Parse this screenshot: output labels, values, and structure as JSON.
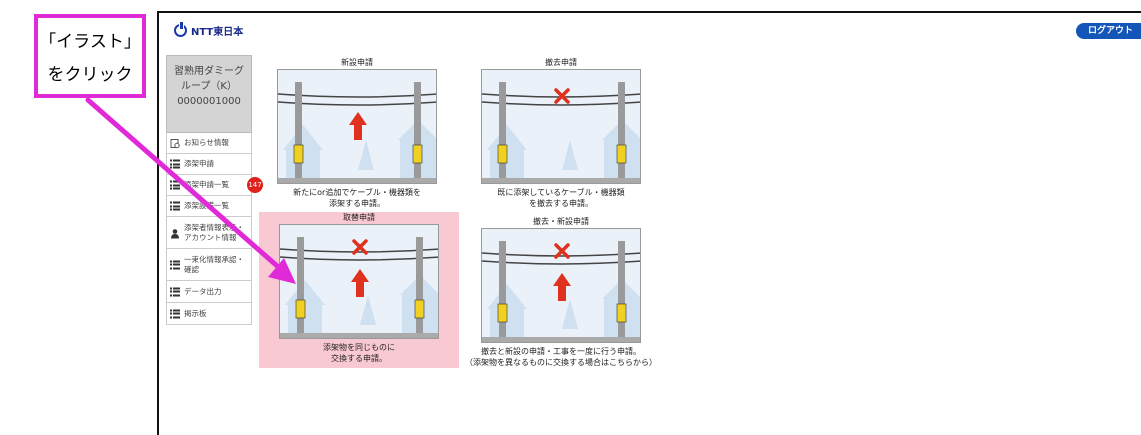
{
  "callout": {
    "line1": "「イラスト」",
    "line2": "をクリック"
  },
  "header": {
    "logo_text": "NTT東日本",
    "logout_label": "ログアウト"
  },
  "sidebar": {
    "group": {
      "line1": "習熟用ダミーグ",
      "line2": "ループ（K）",
      "line3": "0000001000"
    },
    "items": [
      {
        "label": "お知らせ情報",
        "icon": "notification-icon"
      },
      {
        "label": "添架申請",
        "icon": "list-icon"
      },
      {
        "label": "添架申請一覧",
        "icon": "list-icon",
        "badge": "147"
      },
      {
        "label": "添架設備一覧",
        "icon": "list-icon"
      },
      {
        "label": "添架者情報表示・アカウント情報",
        "icon": "person-icon"
      },
      {
        "label": "一束化情報承認・確認",
        "icon": "list-icon"
      },
      {
        "label": "データ出力",
        "icon": "list-icon"
      },
      {
        "label": "掲示板",
        "icon": "list-icon"
      }
    ]
  },
  "cards": {
    "new": {
      "title": "新設申請",
      "desc1": "新たにor追加でケーブル・機器類を",
      "desc2": "添架する申請。"
    },
    "remove": {
      "title": "撤去申請",
      "desc1": "既に添架しているケーブル・機器類",
      "desc2": "を撤去する申請。"
    },
    "replace": {
      "title": "取替申請",
      "desc1": "添架物を同じものに",
      "desc2": "交換する申請。"
    },
    "remove_new": {
      "title": "撤去・新設申請",
      "desc1": "撤去と新設の申請・工事を一度に行う申請。",
      "desc2": "（添架物を異なるものに交換する場合はこちらから）"
    }
  },
  "colors": {
    "callout_border": "#e02ad8",
    "arrow": "#e02ad8",
    "highlight": "#f9c9d3",
    "logout_bg": "#1456b8",
    "badge": "#e0201a"
  }
}
